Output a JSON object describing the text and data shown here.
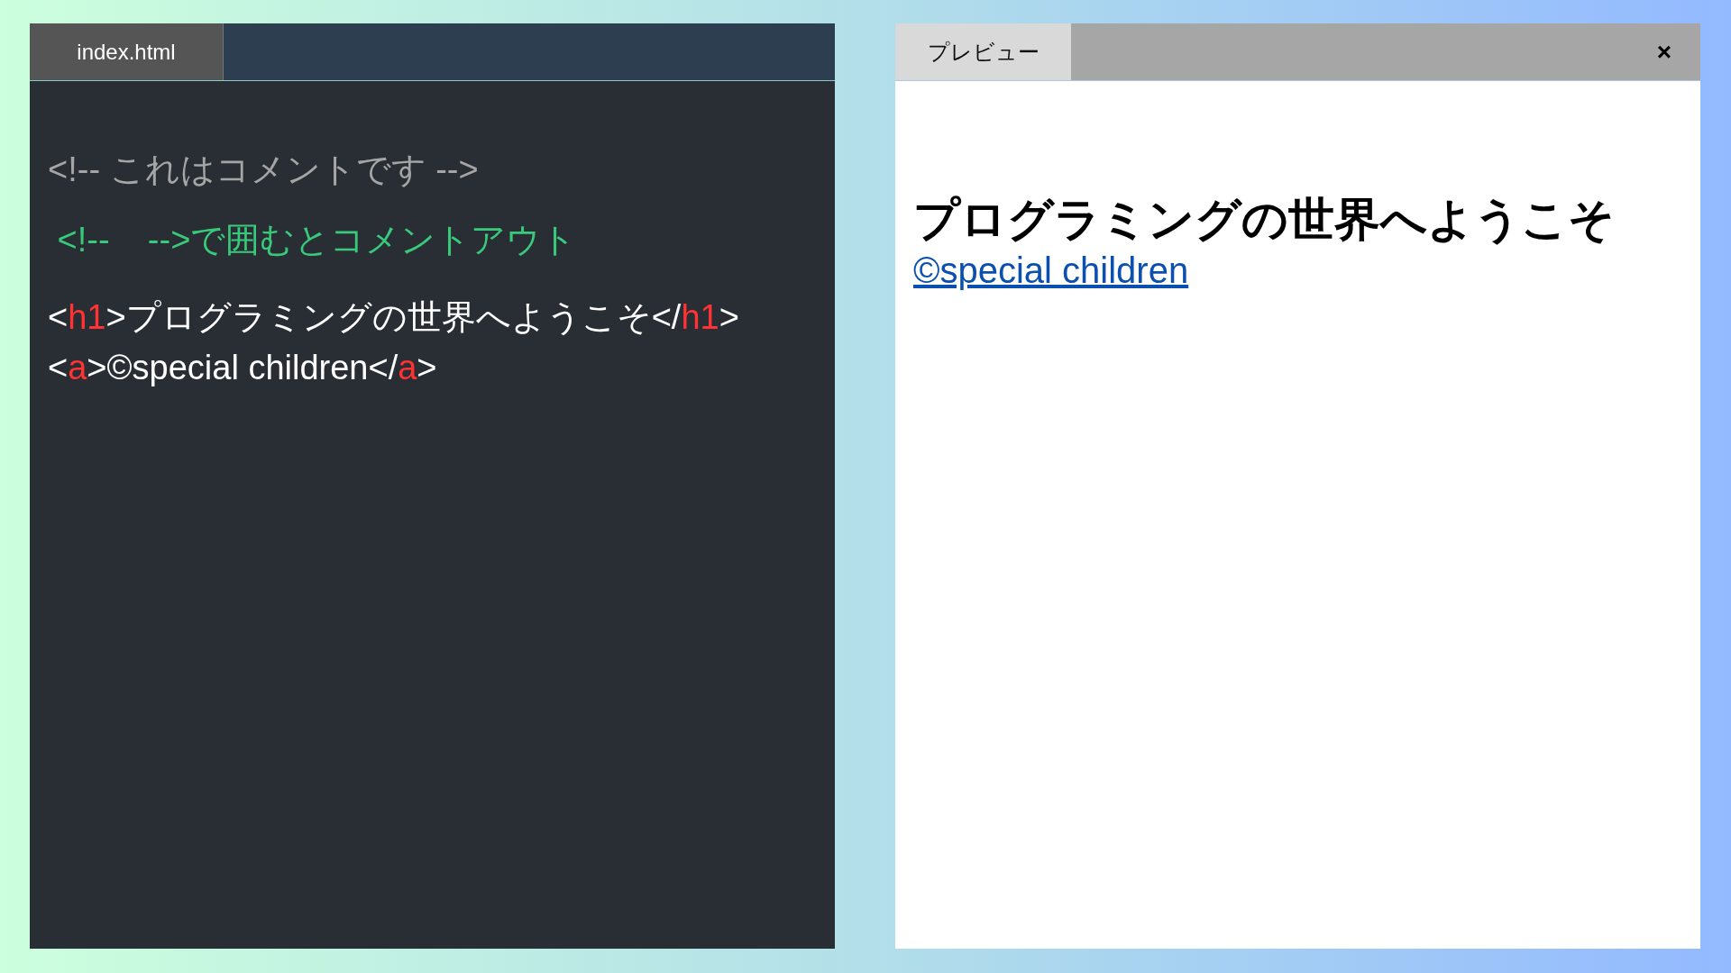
{
  "editor": {
    "tab": {
      "label": "index.html"
    },
    "lines": [
      {
        "segments": [
          {
            "text": "<!-- これはコメントです -->",
            "kind": "comment"
          }
        ]
      },
      {
        "segments": [
          {
            "text": " <!--    -->で囲むとコメントアウト",
            "kind": "note"
          }
        ]
      },
      {
        "segments": [
          {
            "text": "<",
            "kind": "text"
          },
          {
            "text": "h1",
            "kind": "tag"
          },
          {
            "text": ">プログラミングの世界へようこそ</",
            "kind": "text"
          },
          {
            "text": "h1",
            "kind": "tag"
          },
          {
            "text": ">",
            "kind": "text"
          }
        ]
      },
      {
        "segments": [
          {
            "text": "<",
            "kind": "text"
          },
          {
            "text": "a",
            "kind": "tag"
          },
          {
            "text": ">©special children</",
            "kind": "text"
          },
          {
            "text": "a",
            "kind": "tag"
          },
          {
            "text": ">",
            "kind": "text"
          }
        ]
      }
    ]
  },
  "preview": {
    "tab": {
      "label": "プレビュー"
    },
    "close": "×",
    "heading": "プログラミングの世界へようこそ",
    "link": "©special children"
  }
}
